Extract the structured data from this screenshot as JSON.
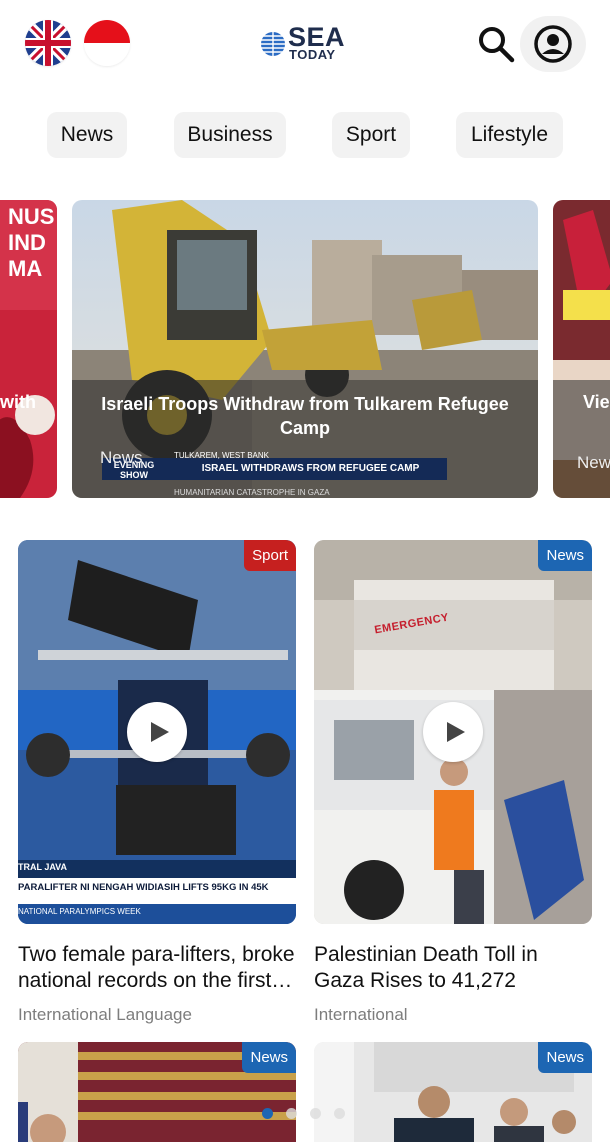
{
  "header": {
    "logo_main": "SEA",
    "logo_sub": "TODAY",
    "flags": [
      "english-flag-icon",
      "indonesian-flag-icon"
    ],
    "icons": [
      "search-icon",
      "account-icon"
    ]
  },
  "tabs": [
    {
      "label": "News"
    },
    {
      "label": "Business"
    },
    {
      "label": "Sport"
    },
    {
      "label": "Lifestyle"
    }
  ],
  "carousel": {
    "left_slide": {
      "caption": "with",
      "banner": "NUS IND MA"
    },
    "main_slide": {
      "caption": "Israeli Troops Withdraw from Tulkarem Refugee Camp",
      "category": "News",
      "lower_third_location": "TULKAREM, WEST BANK",
      "lower_third_headline": "ISRAEL WITHDRAWS FROM REFUGEE CAMP",
      "lower_third_sub": "HUMANITARIAN CATASTROPHE IN GAZA",
      "show_label": "EVENING SHOW"
    },
    "right_slide": {
      "caption": "Vie",
      "category": "New"
    }
  },
  "cards": [
    {
      "badge": "Sport",
      "title": "Two female para-lifters, broke national records on the first…",
      "subtitle": "International Language",
      "overlay_line1": "TRAL JAVA",
      "overlay_line2": "PARALIFTER NI NENGAH WIDIASIH LIFTS 95KG IN 45K",
      "overlay_line3": "NATIONAL PARALYMPICS WEEK"
    },
    {
      "badge": "News",
      "title": "Palestinian Death Toll in Gaza Rises to 41,272",
      "subtitle": "International",
      "sign_text": "EMERGENCY"
    },
    {
      "badge": "News"
    },
    {
      "badge": "News"
    }
  ],
  "colors": {
    "sport_badge": "#c6201f",
    "news_badge": "#1d66b3",
    "tab_background": "#f2f2f2",
    "logo_text": "#1f2d4d"
  }
}
